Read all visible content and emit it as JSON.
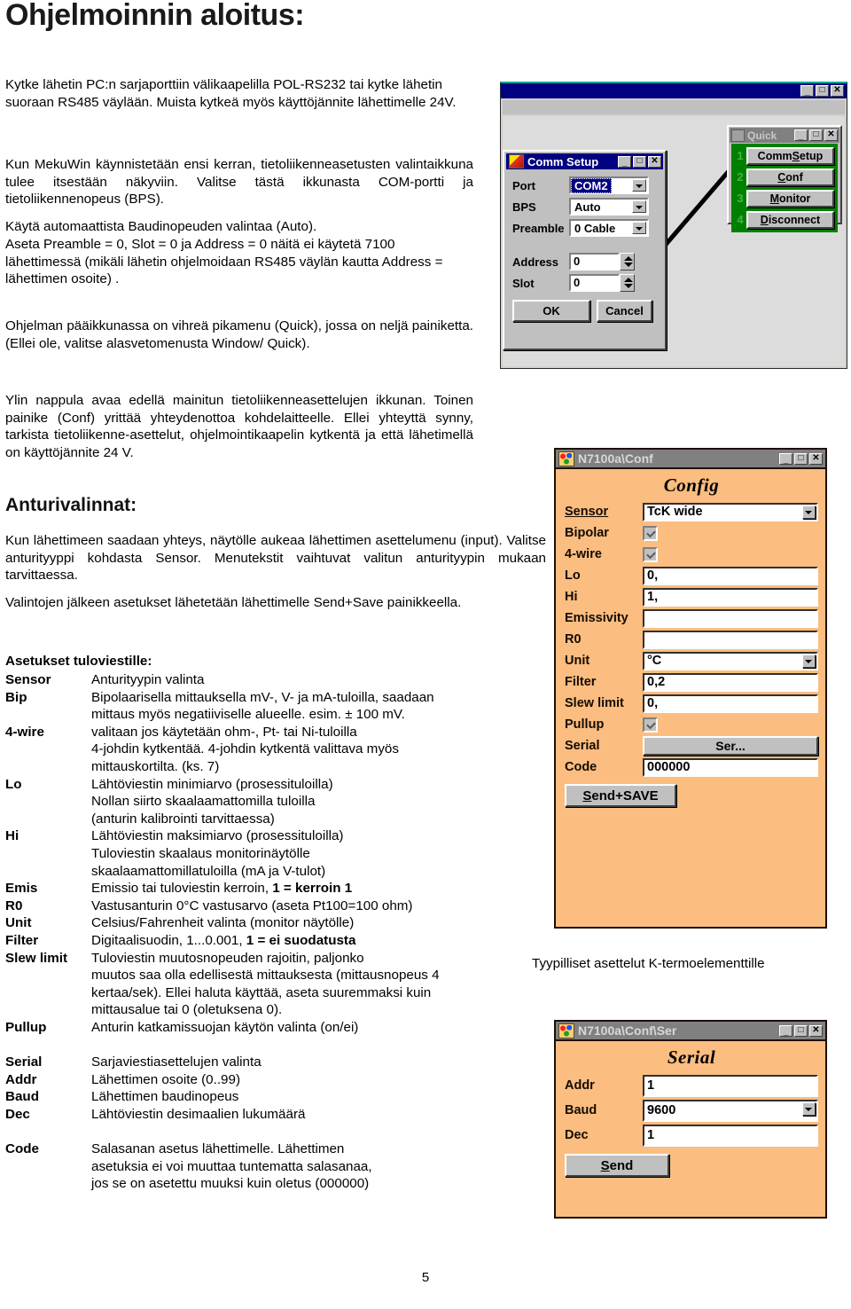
{
  "document": {
    "title": "Ohjelmoinnin aloitus:",
    "page_number": "5",
    "paragraphs": {
      "p1": "Kytke lähetin PC:n sarjaporttiin välikaapelilla POL-RS232 tai kytke lähetin suoraan RS485 väylään. Muista kytkeä myös käyttöjännite lähettimelle 24V.",
      "p2": "Kun MekuWin käynnistetään ensi kerran, tietoliikenneasetusten valintaikkuna tulee itsestään näkyviin. Valitse tästä ikkunasta COM-portti ja tietoliikennenopeus (BPS).",
      "p3": "Käytä automaattista Baudinopeuden valintaa  (Auto).",
      "p4": "Aseta Preamble = 0, Slot = 0 ja Address = 0 näitä ei käytetä 7100 lähettimessä (mikäli lähetin ohjelmoidaan RS485 väylän kautta Address = lähettimen osoite) .",
      "p5": "Ohjelman pääikkunassa on vihreä pikamenu (Quick), jossa on neljä painiketta. (Ellei ole, valitse alasvetomenusta Window/ Quick).",
      "p6": "Ylin nappula avaa edellä mainitun tietoliikenneasettelujen ikkunan.  Toinen painike (Conf) yrittää yhteydenottoa kohdelaitteelle. Ellei yhteyttä synny, tarkista tietoliikenne-asettelut, ohjelmointikaapelin kytkentä ja että lähetimellä on käyttöjännite 24 V.",
      "p7": "Kun lähettimeen saadaan  yhteys,  näytölle aukeaa lähettimen asettelumenu (input).  Valitse  anturityyppi kohdasta Sensor. Menutekstit vaihtuvat valitun anturityypin mukaan tarvittaessa.",
      "p8": "Valintojen jälkeen asetukset  lähetetään lähettimelle Send+Save painikkeella."
    },
    "headings": {
      "anturivalinnat": "Anturivalinnat:",
      "asetukset": "Asetukset tuloviestille:"
    },
    "caption_thermo": "Tyypilliset asettelut K-termoelementtille",
    "definitions": [
      {
        "term": "Sensor",
        "lines": [
          "Anturityypin valinta"
        ]
      },
      {
        "term": "Bip",
        "lines": [
          "Bipolaarisella mittauksella mV-, V- ja mA-tuloilla, saadaan",
          "mittaus myös negatiiviselle alueelle. esim. ± 100 mV."
        ]
      },
      {
        "term": "4-wire",
        "lines": [
          "valitaan jos käytetään ohm-, Pt- tai Ni-tuloilla",
          "4-johdin kytkentää. 4-johdin kytkentä valittava myös",
          "mittauskortilta. (ks. 7)"
        ]
      },
      {
        "term": "Lo",
        "lines": [
          "Lähtöviestin minimiarvo (prosessituloilla)",
          "Nollan siirto skaalaamattomilla tuloilla",
          "(anturin kalibrointi tarvittaessa)"
        ]
      },
      {
        "term": "Hi",
        "lines": [
          "Lähtöviestin maksimiarvo (prosessituloilla)",
          "Tuloviestin skaalaus monitorinäytölle",
          "skaalaamattomillatuloilla (mA ja V-tulot)"
        ]
      },
      {
        "term": "Emis",
        "lines": [
          "Emissio tai tuloviestin kerroin, <b>1 = kerroin 1</b>"
        ]
      },
      {
        "term": "R0",
        "lines": [
          "Vastusanturin 0°C vastusarvo (aseta Pt100=100 ohm)"
        ]
      },
      {
        "term": "Unit",
        "lines": [
          "Celsius/Fahrenheit  valinta (monitor näytölle)"
        ]
      },
      {
        "term": "Filter",
        "lines": [
          "Digitaalisuodin, 1...0.001,   <b>1 = ei suodatusta</b>"
        ]
      },
      {
        "term": "Slew limit",
        "lines": [
          "Tuloviestin muutosnopeuden rajoitin, paljonko",
          "muutos saa olla edellisestä mittauksesta (mittausnopeus 4",
          "kertaa/sek). Ellei haluta käyttää, aseta suuremmaksi kuin",
          "mittausalue tai 0  (oletuksena 0)."
        ]
      },
      {
        "term": "Pullup",
        "lines": [
          "Anturin katkamissuojan käytön valinta (on/ei)"
        ]
      },
      {
        "term": "",
        "lines": [
          ""
        ]
      },
      {
        "term": "Serial",
        "lines": [
          "Sarjaviestiasettelujen valinta"
        ]
      },
      {
        "term": "Addr",
        "lines": [
          "Lähettimen osoite (0..99)"
        ]
      },
      {
        "term": "Baud",
        "lines": [
          "Lähettimen baudinopeus"
        ]
      },
      {
        "term": "Dec",
        "lines": [
          "Lähtöviestin desimaalien lukumäärä"
        ]
      },
      {
        "term": "",
        "lines": [
          ""
        ]
      },
      {
        "term": "Code",
        "lines": [
          "Salasanan asetus lähettimelle. Lähettimen",
          "asetuksia ei voi muuttaa tuntematta salasanaa,",
          "jos se on asetettu muuksi kuin oletus (000000)"
        ]
      }
    ]
  },
  "screenshot_mekuwin": {
    "window_buttons": {
      "minimize": "_",
      "maximize": "□",
      "close": "✕"
    },
    "comm_setup": {
      "title": "Comm Setup",
      "buttons": {
        "minimize": "_",
        "maximize": "□",
        "close": "✕"
      },
      "fields": [
        {
          "label": "Port",
          "value": "COM2",
          "type": "combo",
          "selected": true
        },
        {
          "label": "BPS",
          "value": "Auto",
          "type": "combo",
          "selected": false
        },
        {
          "label": "Preamble",
          "value": "0 Cable",
          "type": "combo",
          "selected": false
        },
        {
          "label": "Address",
          "value": "0",
          "type": "spin"
        },
        {
          "label": "Slot",
          "value": "0",
          "type": "spin"
        }
      ],
      "ok_label": "OK",
      "ok_accel": "O",
      "cancel_label": "Cancel",
      "cancel_accel": "C"
    },
    "quick": {
      "title": "Quick",
      "buttons": {
        "minimize": "_",
        "maximize": "□",
        "close": "✕"
      },
      "items": [
        {
          "number": "1",
          "label_pre": "Comm ",
          "accel": "S",
          "label_post": "etup"
        },
        {
          "number": "2",
          "label_pre": "",
          "accel": "C",
          "label_post": "onf"
        },
        {
          "number": "3",
          "label_pre": "",
          "accel": "M",
          "label_post": "onitor"
        },
        {
          "number": "4",
          "label_pre": "",
          "accel": "D",
          "label_post": "isconnect"
        }
      ]
    }
  },
  "screenshot_config": {
    "title": "N7100a\\Conf",
    "heading": "Config",
    "buttons": {
      "minimize": "_",
      "maximize": "□",
      "close": "✕"
    },
    "rows": [
      {
        "label": "Sensor",
        "type": "combo",
        "value": "TcK wide",
        "underline": true
      },
      {
        "label": "Bipolar",
        "type": "check",
        "value": ""
      },
      {
        "label": "4-wire",
        "type": "check",
        "value": ""
      },
      {
        "label": "Lo",
        "type": "text",
        "value": "0,"
      },
      {
        "label": "Hi",
        "type": "text",
        "value": "1,"
      },
      {
        "label": "Emissivity",
        "type": "text",
        "value": ""
      },
      {
        "label": "R0",
        "type": "text",
        "value": ""
      },
      {
        "label": "Unit",
        "type": "combo",
        "value": "°C"
      },
      {
        "label": "Filter",
        "type": "text",
        "value": "0,2"
      },
      {
        "label": "Slew limit",
        "type": "text",
        "value": "0,"
      },
      {
        "label": "Pullup",
        "type": "check",
        "value": ""
      },
      {
        "label": "Serial",
        "type": "button",
        "value": "Ser..."
      },
      {
        "label": "Code",
        "type": "text",
        "value": "000000"
      }
    ],
    "send_save_pre": "S",
    "send_save_post": "end+SAVE"
  },
  "screenshot_serial": {
    "title": "N7100a\\Conf\\Ser",
    "heading": "Serial",
    "buttons": {
      "minimize": "_",
      "maximize": "□",
      "close": "✕"
    },
    "rows": [
      {
        "label": "Addr",
        "type": "text",
        "value": "1"
      },
      {
        "label": "Baud",
        "type": "combo",
        "value": "9600"
      },
      {
        "label": "Dec",
        "type": "text",
        "value": "1"
      }
    ],
    "send_pre": "S",
    "send_post": "end"
  },
  "colors": {
    "titlebar_active": "#000080",
    "dialog_face": "#c0c0c0",
    "quick_green": "#008000",
    "n71_orange": "#fbbd80",
    "teal_rule": "#0aa79b"
  }
}
